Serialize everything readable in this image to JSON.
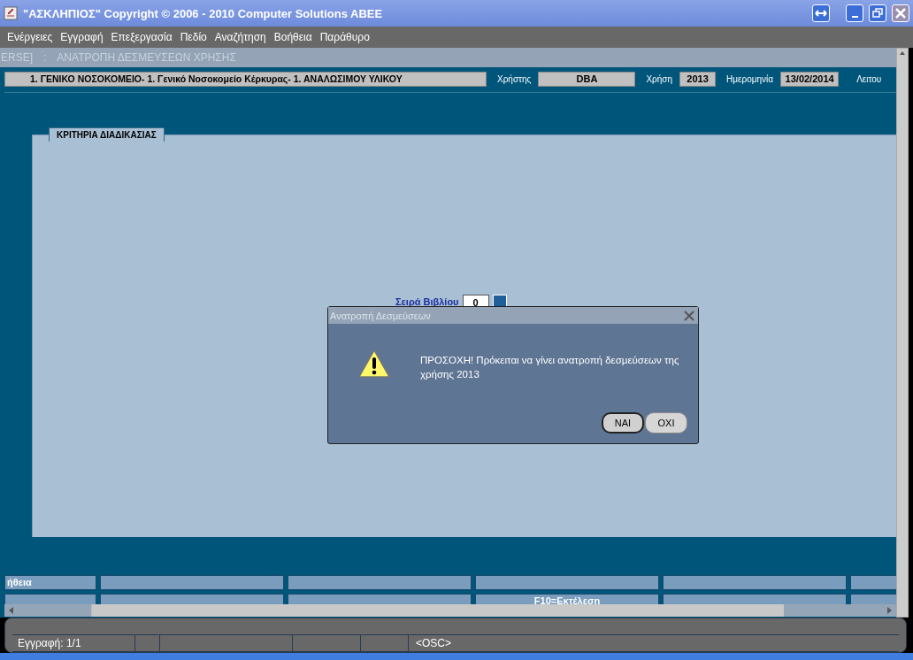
{
  "window": {
    "title": "\"ΑΣΚΛΗΠΙΟΣ\" Copyright © 2006 - 2010 Computer Solutions ABEE"
  },
  "menu": [
    "Ενέργειες",
    "Εγγραφή",
    "Επεξεργασία",
    "Πεδίο",
    "Αναζήτηση",
    "Βοήθεια",
    "Παράθυρο"
  ],
  "breadcrumb": {
    "module": "ERSE]",
    "separator": ":",
    "form": "ΑΝΑΤΡΟΠΗ ΔΕΣΜΕΥΣΕΩΝ ΧΡΗΣΗΣ"
  },
  "header": {
    "organization": "1. ΓΕΝΙΚΟ ΝΟΣΟΚΟΜΕΙΟ- 1. Γενικό Νοσοκομείο Κέρκυρας- 1. ΑΝΑΛΩΣΙΜΟΥ ΥΛΙΚΟΥ",
    "fields": [
      {
        "label": "Χρήστης",
        "value": "DBA"
      },
      {
        "label": "Χρήση",
        "value": "2013"
      },
      {
        "label": "Ημερομηνία",
        "value": "13/02/2014"
      }
    ],
    "trailing_label": "Λειτου"
  },
  "panel": {
    "tab": "ΚΡΙΤΗΡΙΑ ΔΙΑΔΙΚΑΣΙΑΣ",
    "field": {
      "label": "Σειρά Βιβλίου",
      "value": "0"
    }
  },
  "dialog": {
    "title": "Ανατροπή Δεσμεύσεων",
    "message": "ΠΡΟΣΟΧΗ! Πρόκειται να γίνει ανατροπή δεσμεύσεων της χρήσης 2013",
    "buttons": [
      {
        "label": "ΝΑΙ",
        "selected": true
      },
      {
        "label": "ΟΧΙ",
        "selected": false
      }
    ]
  },
  "function_keys": {
    "row_1": {
      "key_1": "ήθεια"
    },
    "row_2": {
      "key_4": "F10=Εκτέλεση"
    }
  },
  "status_bar": {
    "record": "Εγγραφή: 1/1",
    "mode": "<OSC>"
  }
}
